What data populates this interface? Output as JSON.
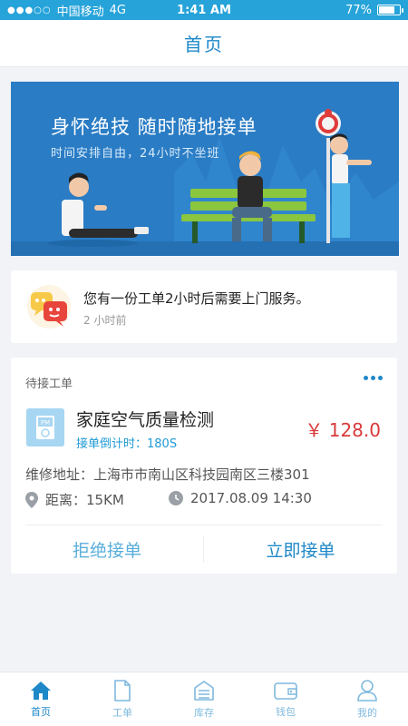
{
  "status_bar": {
    "carrier": "中国移动",
    "network": "4G",
    "time": "1:41 AM",
    "battery_text": "77%",
    "battery_level": 0.77
  },
  "nav": {
    "title": "首页"
  },
  "banner": {
    "title": "身怀绝技 随时随地接单",
    "subtitle": "时间安排自由，24小时不坐班"
  },
  "notice": {
    "text": "您有一份工单2小时后需要上门服务。",
    "time": "2 小时前"
  },
  "order": {
    "section_label": "待接工单",
    "title": "家庭空气质量检测",
    "countdown": "接单倒计时：180S",
    "price": "￥ 128.0",
    "address": "维修地址：上海市市南山区科技园南区三楼301",
    "distance": "距离：15KM",
    "datetime": "2017.08.09 14:30",
    "reject_label": "拒绝接单",
    "accept_label": "立即接单",
    "pm_label": "PM"
  },
  "tabs": [
    {
      "label": "首页",
      "icon": "home-icon",
      "active": true
    },
    {
      "label": "工单",
      "icon": "document-icon",
      "active": false
    },
    {
      "label": "库存",
      "icon": "inventory-icon",
      "active": false
    },
    {
      "label": "钱包",
      "icon": "wallet-icon",
      "active": false
    },
    {
      "label": "我的",
      "icon": "user-icon",
      "active": false
    }
  ],
  "colors": {
    "accent": "#1e88c8",
    "status_bar": "#26a3d9",
    "banner_bg": "#2a7cc4",
    "price": "#d93a3a"
  }
}
